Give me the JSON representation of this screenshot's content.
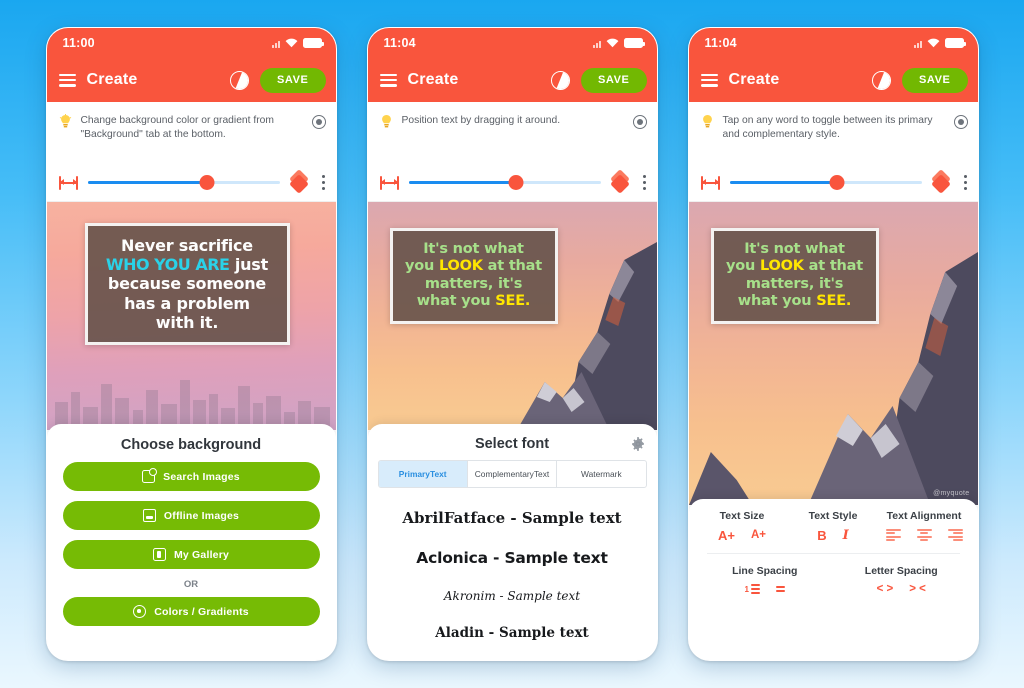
{
  "phones": [
    {
      "id": "phone-background",
      "status": {
        "time": "11:00",
        "wifi_icon": "wifi-icon",
        "battery_icon": "battery-icon",
        "signal_icon": "signal-icon"
      },
      "appbar": {
        "menu_icon": "hamburger-menu-icon",
        "title": "Create",
        "contrast_icon": "contrast-icon",
        "save_label": "SAVE"
      },
      "tip": {
        "bulb_icon": "lightbulb-icon",
        "text": "Change background color or gradient from \"Background\" tab at the bottom.",
        "close_icon": "close-circle-icon"
      },
      "toolbar": {
        "width_icon": "width-adjust-icon",
        "slider_value": 62,
        "layers_icon": "layers-icon",
        "more_icon": "more-vertical-icon"
      },
      "canvas": {
        "background_description": "pink sunset sky with city skyline",
        "quote_lines": [
          [
            {
              "t": "Never sacrifice",
              "hl": false
            }
          ],
          [
            {
              "t": "WHO YOU ARE",
              "hl": true
            },
            {
              "t": " just",
              "hl": false
            }
          ],
          [
            {
              "t": "because someone",
              "hl": false
            }
          ],
          [
            {
              "t": "has a problem",
              "hl": false
            }
          ],
          [
            {
              "t": "with it.",
              "hl": false
            }
          ]
        ]
      },
      "sheet": {
        "kind": "choose-background",
        "title": "Choose background",
        "buttons": [
          {
            "label": "Search Images",
            "icon": "search-images-icon"
          },
          {
            "label": "Offline Images",
            "icon": "offline-images-icon"
          },
          {
            "label": "My Gallery",
            "icon": "my-gallery-icon"
          }
        ],
        "or_label": "OR",
        "last_button": {
          "label": "Colors / Gradients",
          "icon": "palette-icon"
        }
      }
    },
    {
      "id": "phone-select-font",
      "status": {
        "time": "11:04",
        "wifi_icon": "wifi-icon",
        "battery_icon": "battery-icon",
        "signal_icon": "signal-icon"
      },
      "appbar": {
        "menu_icon": "hamburger-menu-icon",
        "title": "Create",
        "contrast_icon": "contrast-icon",
        "save_label": "SAVE"
      },
      "tip": {
        "bulb_icon": "lightbulb-icon",
        "text": "Position text by dragging it around.",
        "close_icon": "close-circle-icon"
      },
      "toolbar": {
        "width_icon": "width-adjust-icon",
        "slider_value": 56,
        "layers_icon": "layers-icon",
        "more_icon": "more-vertical-icon"
      },
      "canvas": {
        "background_description": "orange sunset sky with snowy mountain",
        "quote_lines": [
          [
            {
              "t": "It's not what",
              "hl": false
            }
          ],
          [
            {
              "t": "you ",
              "hl": false
            },
            {
              "t": "LOOK",
              "hl": true
            },
            {
              "t": " at that",
              "hl": false
            }
          ],
          [
            {
              "t": "matters, it's",
              "hl": false
            }
          ],
          [
            {
              "t": "what you ",
              "hl": false
            },
            {
              "t": "SEE.",
              "hl": true
            }
          ]
        ]
      },
      "sheet": {
        "kind": "select-font",
        "title": "Select font",
        "settings_icon": "gear-icon",
        "tabs": [
          {
            "label": "PrimaryText",
            "active": true
          },
          {
            "label": "ComplementaryText",
            "active": false
          },
          {
            "label": "Watermark",
            "active": false
          }
        ],
        "fonts": [
          {
            "label": "AbrilFatface - Sample text",
            "style": "f-abril"
          },
          {
            "label": "Aclonica - Sample text",
            "style": "f-aclonica"
          },
          {
            "label": "Akronim - Sample text",
            "style": "f-akronim"
          },
          {
            "label": "Aladin - Sample text",
            "style": "f-aladin"
          }
        ]
      }
    },
    {
      "id": "phone-text-tools",
      "status": {
        "time": "11:04",
        "wifi_icon": "wifi-icon",
        "battery_icon": "battery-icon",
        "signal_icon": "signal-icon"
      },
      "appbar": {
        "menu_icon": "hamburger-menu-icon",
        "title": "Create",
        "contrast_icon": "contrast-icon",
        "save_label": "SAVE"
      },
      "tip": {
        "bulb_icon": "lightbulb-icon",
        "text": "Tap on any word to toggle between its primary and complementary style.",
        "close_icon": "close-circle-icon"
      },
      "toolbar": {
        "width_icon": "width-adjust-icon",
        "slider_value": 56,
        "layers_icon": "layers-icon",
        "more_icon": "more-vertical-icon"
      },
      "canvas": {
        "background_description": "orange sunset sky with snowy mountain",
        "watermark": "@myquote",
        "quote_lines": [
          [
            {
              "t": "It's not what",
              "hl": false
            }
          ],
          [
            {
              "t": "you ",
              "hl": false
            },
            {
              "t": "LOOK",
              "hl": true
            },
            {
              "t": " at that",
              "hl": false
            }
          ],
          [
            {
              "t": "matters, it's",
              "hl": false
            }
          ],
          [
            {
              "t": "what you ",
              "hl": false
            },
            {
              "t": "SEE.",
              "hl": true
            }
          ]
        ]
      },
      "sheet": {
        "kind": "text-tools",
        "groups_row1": [
          {
            "label": "Text Size",
            "icons": [
              "increase-text-size-icon",
              "decrease-text-size-icon"
            ]
          },
          {
            "label": "Text Style",
            "icons": [
              "bold-icon",
              "italic-icon"
            ]
          },
          {
            "label": "Text Alignment",
            "icons": [
              "align-left-icon",
              "align-center-icon",
              "align-right-icon"
            ]
          }
        ],
        "groups_row2": [
          {
            "label": "Line Spacing",
            "icons": [
              "increase-line-spacing-icon",
              "decrease-line-spacing-icon"
            ]
          },
          {
            "label": "Letter Spacing",
            "icons": [
              "increase-letter-spacing-icon",
              "decrease-letter-spacing-icon"
            ]
          }
        ],
        "text_size_icons": [
          "A+",
          "A+"
        ],
        "text_style_icons": [
          "B",
          "I"
        ]
      }
    }
  ],
  "colors": {
    "accent_red": "#f9553d",
    "accent_green": "#76bb05",
    "slider_blue": "#1a8cf0",
    "tab_active_blue": "#2a8fe0",
    "page_background_top": "#1aa7f0",
    "page_background_bottom": "#eaf7fe"
  }
}
